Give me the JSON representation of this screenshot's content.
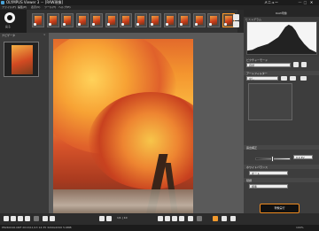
{
  "window": {
    "title": "OLYMPUS Viewer 3 － [RAW現像]",
    "mode_label": "メニュー",
    "minimize": "—",
    "maximize": "□",
    "close": "✕"
  },
  "menu": [
    "ファイル(F)",
    "編集(E)",
    "表示(V)",
    "ツール(T)",
    "ヘルプ(H)"
  ],
  "toolbar": {
    "back_label": "戻る"
  },
  "filmstrip": {
    "selected_index": 13,
    "thumb_count": 14
  },
  "info": {
    "panel_title": "RAW現像"
  },
  "histogram": {
    "title": "ヒストグラム"
  },
  "subwindow": {
    "title": "ナビゲータ",
    "close": "×"
  },
  "right_panel": {
    "picture_mode_label": "ピクチャーモード",
    "picture_mode_value": "自然",
    "art_filter_header": "アートフィルター",
    "art_filter_value": "なし",
    "exposure_header": "露出補正",
    "exposure_value": "0.0 EV",
    "wb_header": "ホワイトバランス",
    "wb_value": "オート",
    "gradation_header": "階調",
    "gradation_value": "標準",
    "apply_button": "現像実行"
  },
  "bottom": {
    "page_counter": "1/1 | 10",
    "fav_label": "☆"
  },
  "status": {
    "left": "P8240016.ORF  2013/11/13  14:35  3200x4320  5.6MB",
    "right": "100%"
  }
}
